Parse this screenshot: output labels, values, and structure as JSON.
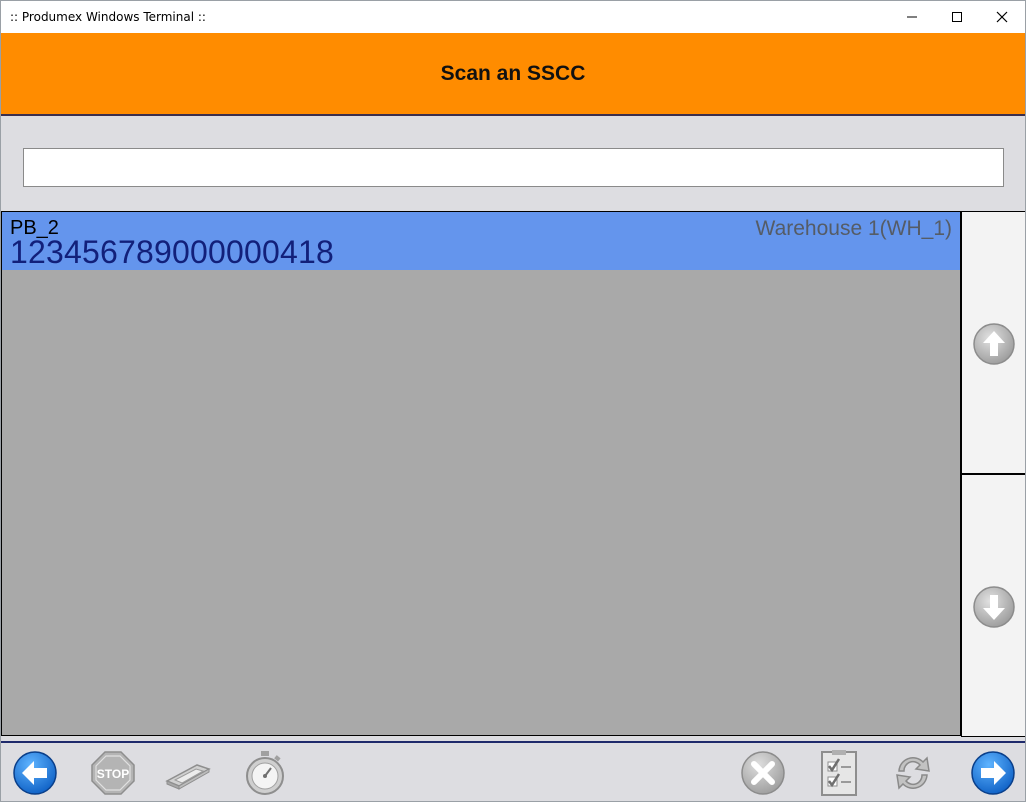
{
  "window": {
    "title": ":: Produmex Windows Terminal ::"
  },
  "header": {
    "title": "Scan an SSCC"
  },
  "scan": {
    "value": "",
    "placeholder": ""
  },
  "list": {
    "rows": [
      {
        "code": "PB_2",
        "sscc": "123456789000000418",
        "warehouse": "Warehouse 1(WH_1)"
      }
    ]
  },
  "colors": {
    "header_bg": "#ff8c00",
    "selected_row_bg": "#6495ed",
    "list_bg": "#a9a9a9",
    "nav_button": "#1e88e5"
  },
  "footer": {
    "buttons": [
      "back-arrow-icon",
      "stop-icon",
      "scanner-icon",
      "stopwatch-icon",
      "cancel-icon",
      "checklist-icon",
      "refresh-icon",
      "forward-arrow-icon"
    ]
  }
}
